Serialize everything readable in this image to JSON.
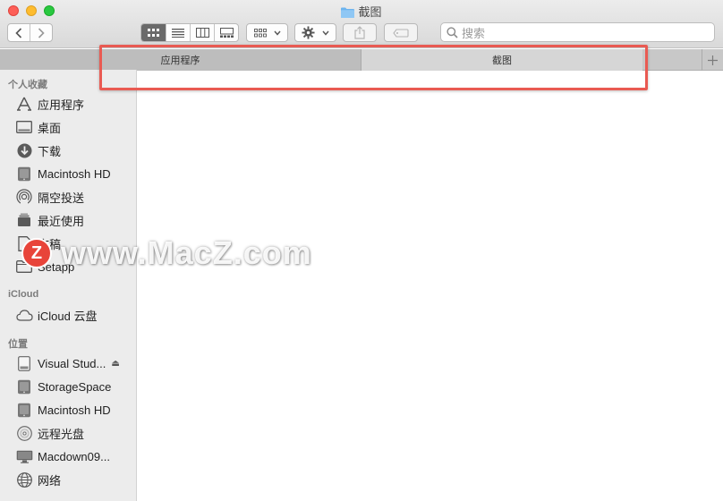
{
  "window": {
    "title": "截图"
  },
  "search": {
    "placeholder": "搜索"
  },
  "tabs": [
    {
      "label": "应用程序"
    },
    {
      "label": "截图"
    }
  ],
  "sidebar": {
    "favorites_title": "个人收藏",
    "favorites": [
      {
        "label": "应用程序",
        "icon": "applications-icon"
      },
      {
        "label": "桌面",
        "icon": "desktop-icon"
      },
      {
        "label": "下载",
        "icon": "download-icon"
      },
      {
        "label": "Macintosh HD",
        "icon": "hard-drive-icon"
      },
      {
        "label": "隔空投送",
        "icon": "airdrop-icon"
      },
      {
        "label": "最近使用",
        "icon": "recents-icon"
      },
      {
        "label": "文稿",
        "icon": "documents-icon"
      },
      {
        "label": "Setapp",
        "icon": "folder-icon"
      }
    ],
    "icloud_title": "iCloud",
    "icloud": [
      {
        "label": "iCloud 云盘",
        "icon": "cloud-icon"
      }
    ],
    "locations_title": "位置",
    "locations": [
      {
        "label": "Visual Stud...",
        "icon": "disk-icon",
        "eject": "⏏"
      },
      {
        "label": "StorageSpace",
        "icon": "disk-icon"
      },
      {
        "label": "Macintosh HD",
        "icon": "hard-drive-icon"
      },
      {
        "label": "远程光盘",
        "icon": "optical-disc-icon"
      },
      {
        "label": "Macdown09...",
        "icon": "computer-icon"
      },
      {
        "label": "网络",
        "icon": "network-icon"
      }
    ]
  },
  "watermark": {
    "badge": "Z",
    "text": "www.MacZ.com"
  },
  "colors": {
    "highlight": "#e95a52",
    "folder": "#6cb4ef",
    "sidebar_bg": "#ececec"
  }
}
